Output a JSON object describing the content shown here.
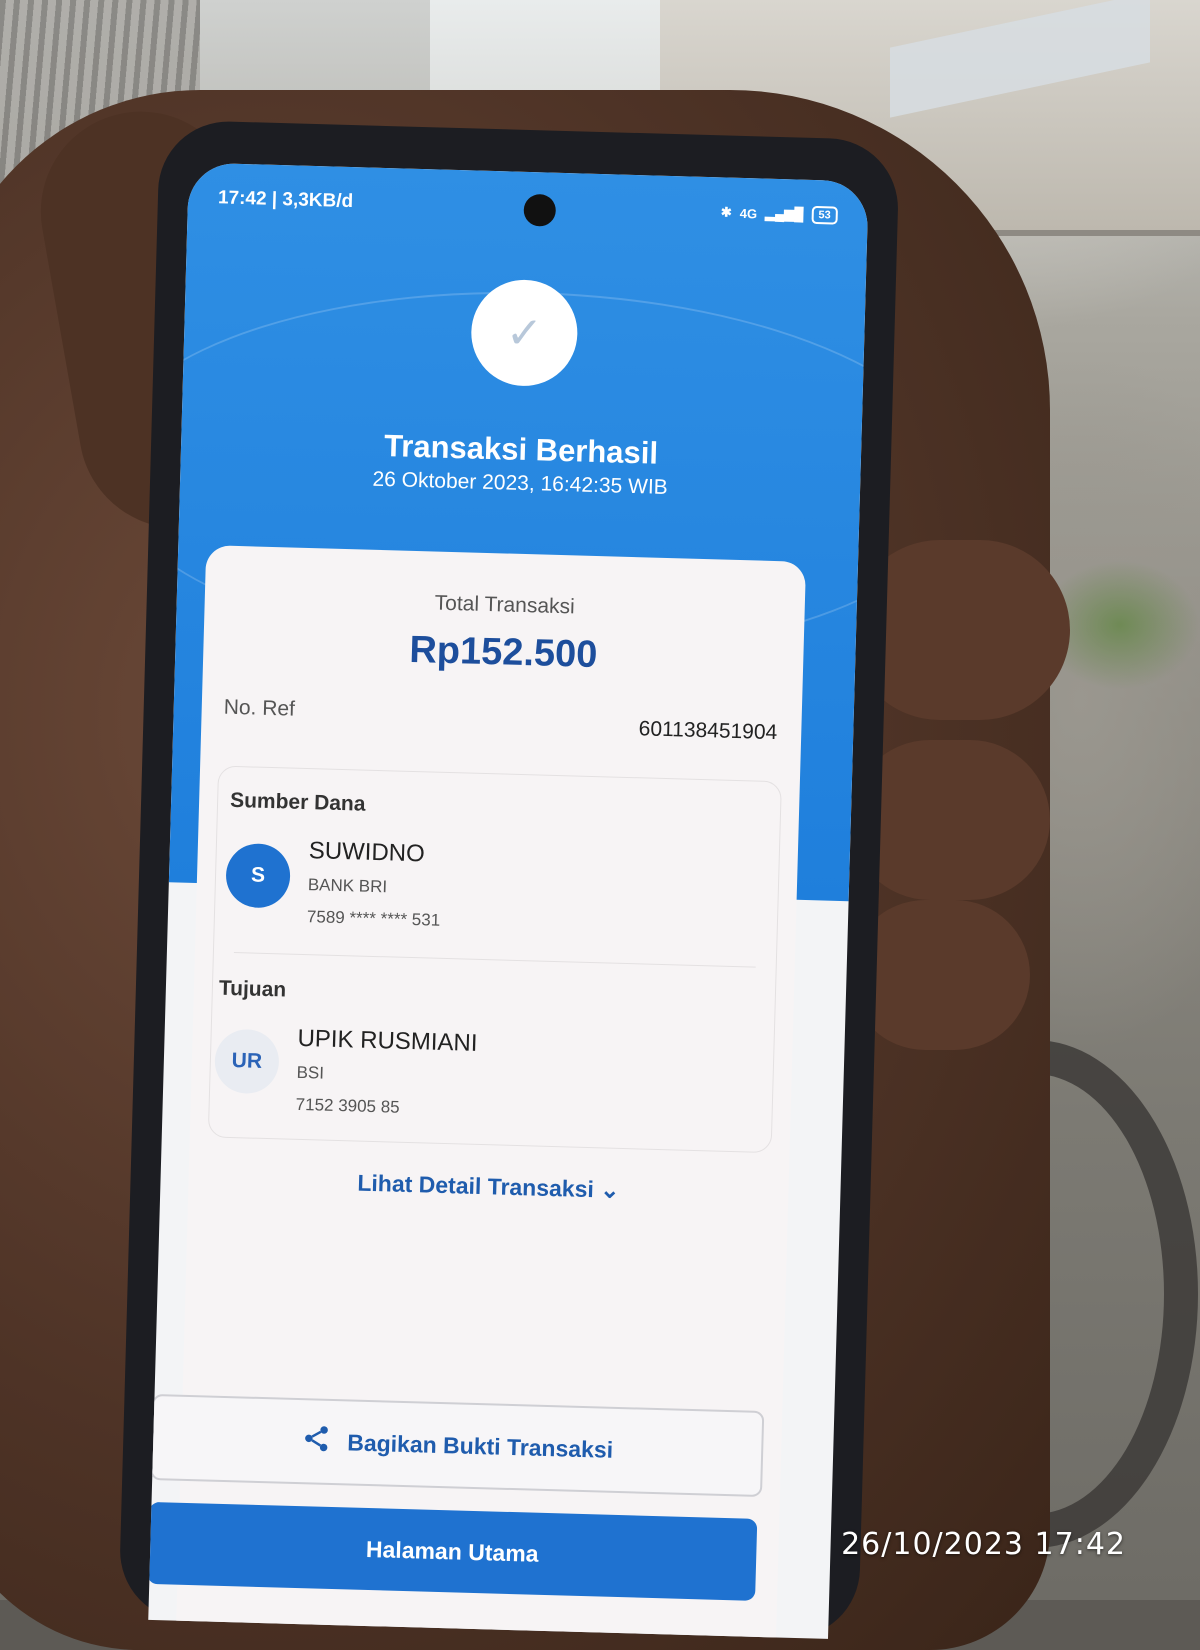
{
  "status_bar": {
    "left": "17:42 | 3,3KB/d",
    "network": "4G",
    "battery": "53"
  },
  "receipt": {
    "title": "Transaksi Berhasil",
    "datetime": "26 Oktober 2023, 16:42:35 WIB",
    "total_label": "Total Transaksi",
    "total_amount": "Rp152.500",
    "ref_label": "No. Ref",
    "ref_value": "601138451904",
    "source": {
      "label": "Sumber Dana",
      "initials": "S",
      "name": "SUWIDNO",
      "bank": "BANK BRI",
      "account": "7589 **** **** 531"
    },
    "destination": {
      "label": "Tujuan",
      "initials": "UR",
      "name": "UPIK RUSMIANI",
      "bank": "BSI",
      "account": "7152 3905 85"
    },
    "detail_link": "Lihat Detail Transaksi",
    "share_button": "Bagikan Bukti Transaksi",
    "home_button": "Halaman Utama"
  },
  "photo_timestamp": "26/10/2023  17:42",
  "colors": {
    "brand_blue": "#1f72d0",
    "amount_blue": "#1d4e9c"
  },
  "icons": [
    "check-icon",
    "share-icon",
    "chevron-down-icon",
    "bluetooth-icon",
    "signal-icon",
    "battery-icon"
  ]
}
